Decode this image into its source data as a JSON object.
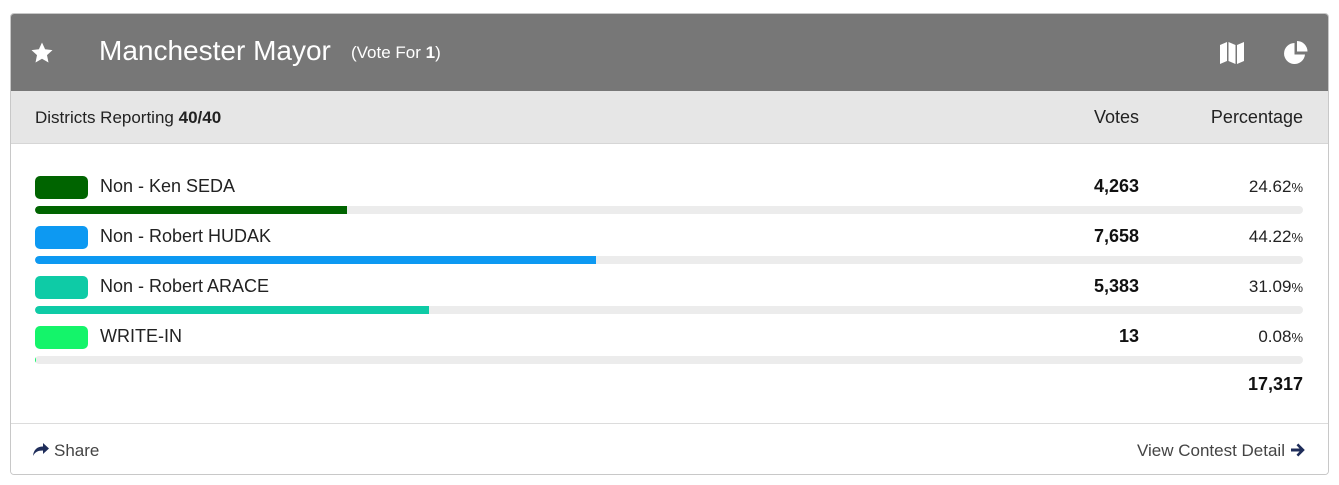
{
  "contest": {
    "title": "Manchester Mayor",
    "vote_for_prefix": "(Vote For ",
    "vote_for_count": "1",
    "vote_for_suffix": ")"
  },
  "header_icons": [
    "star-icon",
    "map-icon",
    "pie-chart-icon"
  ],
  "summary": {
    "districts_label": "Districts Reporting",
    "districts_value": "40/40",
    "votes_header": "Votes",
    "percentage_header": "Percentage"
  },
  "candidates": [
    {
      "name": "Non - Ken SEDA",
      "votes": "4,263",
      "percentage": "24.62",
      "share": 0.2462,
      "color": "#006400"
    },
    {
      "name": "Non - Robert HUDAK",
      "votes": "7,658",
      "percentage": "44.22",
      "share": 0.4422,
      "color": "#0d99f2"
    },
    {
      "name": "Non - Robert ARACE",
      "votes": "5,383",
      "percentage": "31.09",
      "share": 0.3109,
      "color": "#0ecba6"
    },
    {
      "name": "WRITE-IN",
      "votes": "13",
      "percentage": "0.08",
      "share": 0.0008,
      "color": "#14f46a"
    }
  ],
  "percent_sign": "%",
  "total_votes": "17,317",
  "footer": {
    "share_label": "Share",
    "detail_label": "View Contest Detail"
  },
  "colors": {
    "header_bg": "#777777",
    "subheader_bg": "#e6e6e6",
    "link_icon": "#1f2d5a"
  }
}
